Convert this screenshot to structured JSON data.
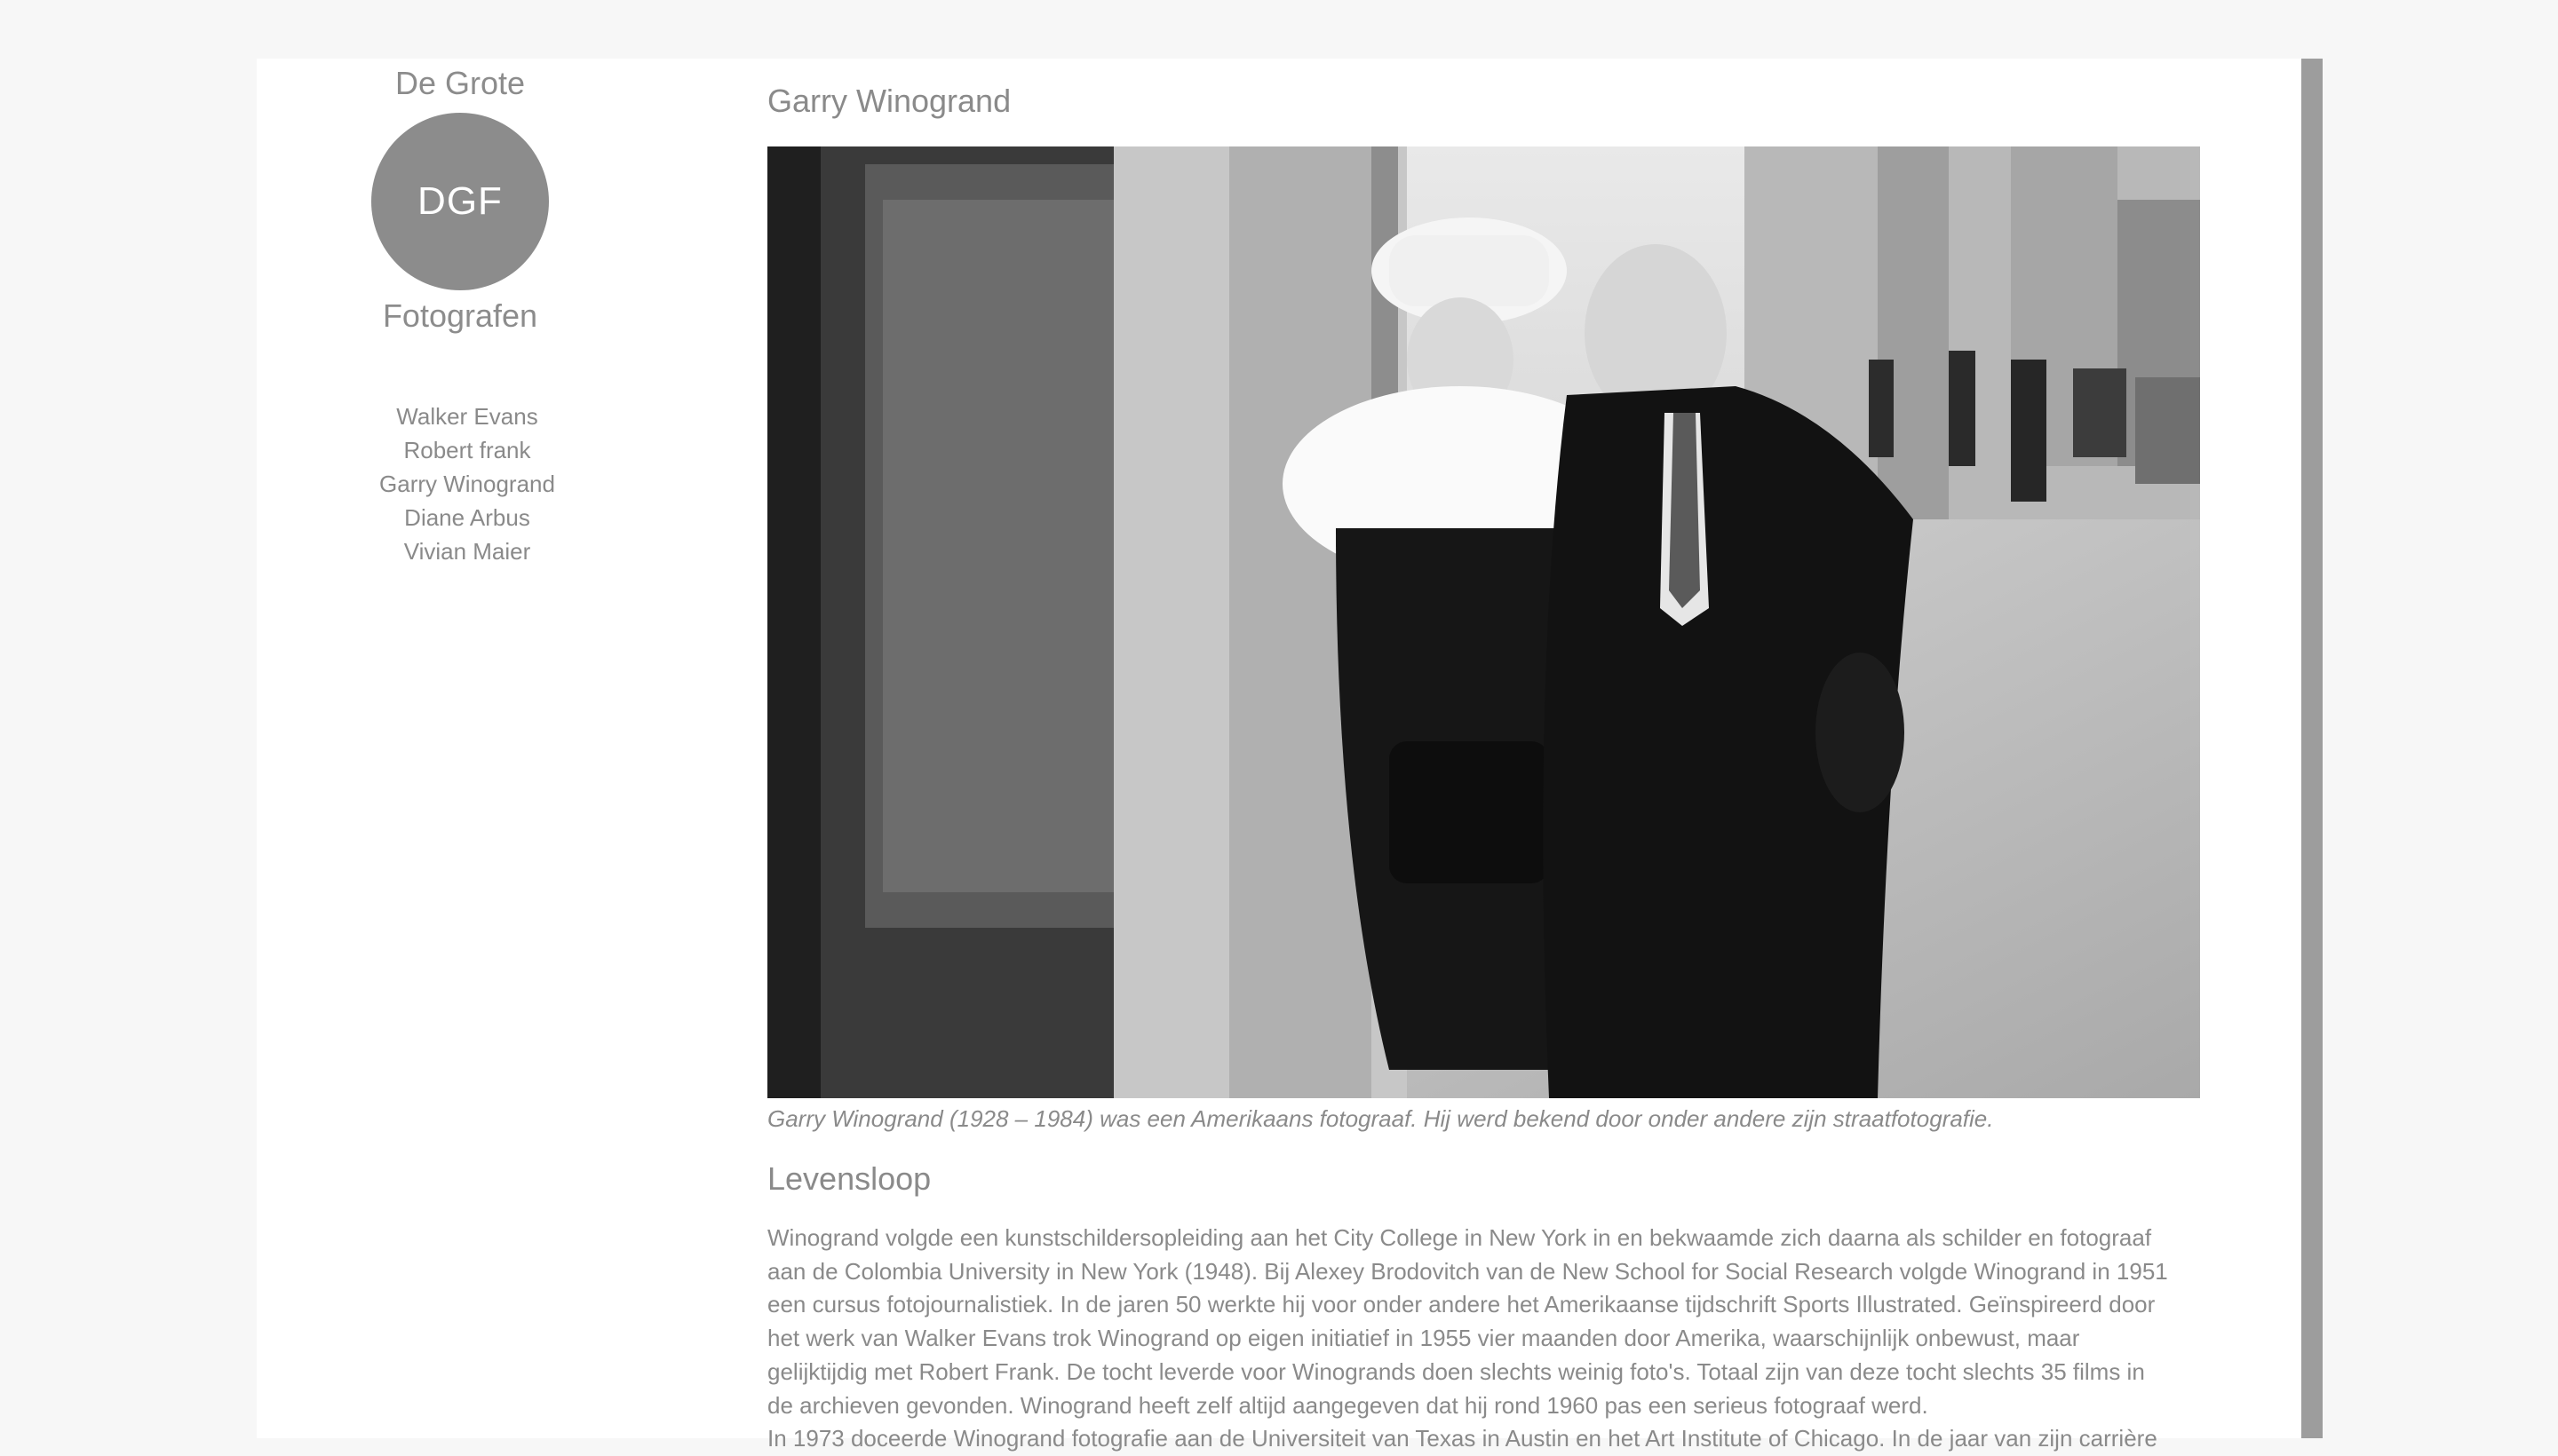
{
  "sidebar": {
    "title_top": "De Grote",
    "logo_text": "DGF",
    "title_bottom": "Fotografen",
    "nav": [
      "Walker Evans",
      "Robert frank",
      "Garry Winogrand",
      "Diane Arbus",
      "Vivian Maier"
    ]
  },
  "main": {
    "title": "Garry Winogrand",
    "photo_icon": "photograph-couple-street",
    "caption": "Garry Winogrand (1928 – 1984) was een Amerikaans fotograaf. Hij werd bekend door onder andere zijn straatfotografie.",
    "section_heading": "Levensloop",
    "body_lines": [
      "Winogrand volgde een kunstschildersopleiding aan het City College in New York in en bekwaamde zich daarna als schilder en fotograaf",
      "aan de Colombia University in New York (1948). Bij Alexey Brodovitch van de New School for Social Research volgde Winogrand in 1951",
      "een cursus fotojournalistiek. In de jaren 50 werkte hij voor onder andere het Amerikaanse tijdschrift Sports Illustrated. Geïnspireerd door",
      "het werk van Walker Evans trok Winogrand op eigen initiatief in 1955 vier maanden door Amerika, waarschijnlijk onbewust, maar",
      "gelijktijdig met Robert Frank. De tocht leverde voor Winogrands doen slechts weinig foto's. Totaal zijn van deze tocht slechts 35 films in",
      "de archieven gevonden. Winogrand heeft zelf altijd aangegeven dat hij rond 1960 pas een serieus fotograaf werd.",
      "In 1973 doceerde Winogrand fotografie aan de Universiteit van Texas in Austin en het Art Institute of Chicago. In de jaar van zijn carrière"
    ]
  }
}
